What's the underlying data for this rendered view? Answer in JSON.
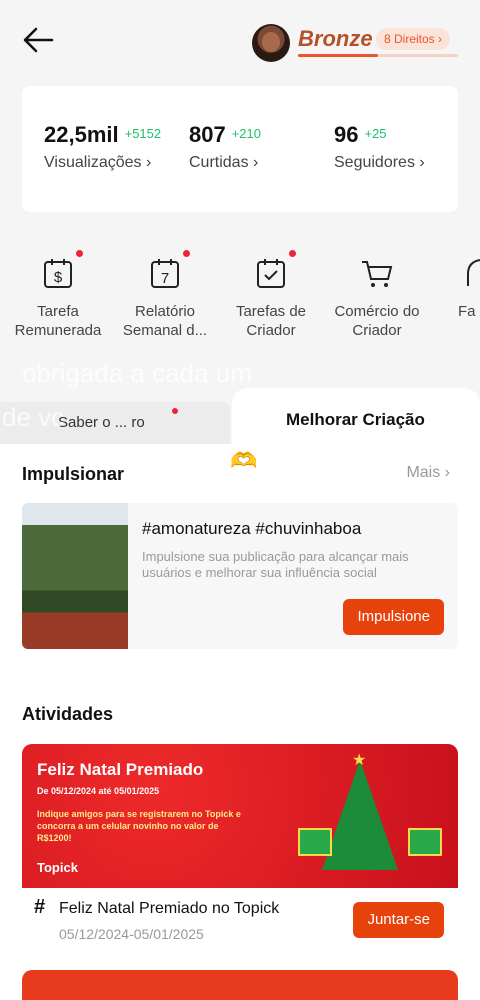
{
  "header": {
    "rank": "Bronze",
    "rights": "8 Direitos",
    "rank_progress": 0.5
  },
  "stats": [
    {
      "value": "22,5mil",
      "delta": "+5152",
      "label": "Visualizações"
    },
    {
      "value": "807",
      "delta": "+210",
      "label": "Curtidas"
    },
    {
      "value": "96",
      "delta": "+25",
      "label": "Seguidores"
    }
  ],
  "tools": [
    {
      "label": "Tarefa Remunerada",
      "icon": "dollar-calendar-icon",
      "badge": true
    },
    {
      "label": "Relatório Semanal d...",
      "icon": "calendar-7-icon",
      "badge": true
    },
    {
      "label": "Tarefas de Criador",
      "icon": "calendar-check-icon",
      "badge": true
    },
    {
      "label": "Comércio do Criador",
      "icon": "cart-icon",
      "badge": false
    },
    {
      "label": "Fa",
      "icon": "partial-icon",
      "badge": false
    }
  ],
  "overlay": {
    "line1": "obrigada a cada um",
    "line2": "de vc"
  },
  "tabs": {
    "left": "Saber o ... ro",
    "right": "Melhorar Criação"
  },
  "boost": {
    "title": "Impulsionar",
    "more": "Mais",
    "tags": "#amonatureza #chuvinhaboa",
    "desc": "Impulsione sua publicação para alcançar mais usuários e melhorar sua influência social",
    "button": "Impulsione"
  },
  "activities": {
    "title": "Atividades",
    "banner": {
      "title": "Feliz Natal Premiado",
      "dates": "De 05/12/2024 até 05/01/2025",
      "text": "Indique amigos para se registrarem no Topick e concorra a um celular novinho no valor de R$1200!",
      "brand": "Topick"
    },
    "item": {
      "name": "Feliz Natal Premiado no Topick",
      "date": "05/12/2024-05/01/2025",
      "button": "Juntar-se"
    }
  },
  "colors": {
    "accent": "#e8420c",
    "positive": "#1fbf6a",
    "badge": "#f0223a"
  }
}
